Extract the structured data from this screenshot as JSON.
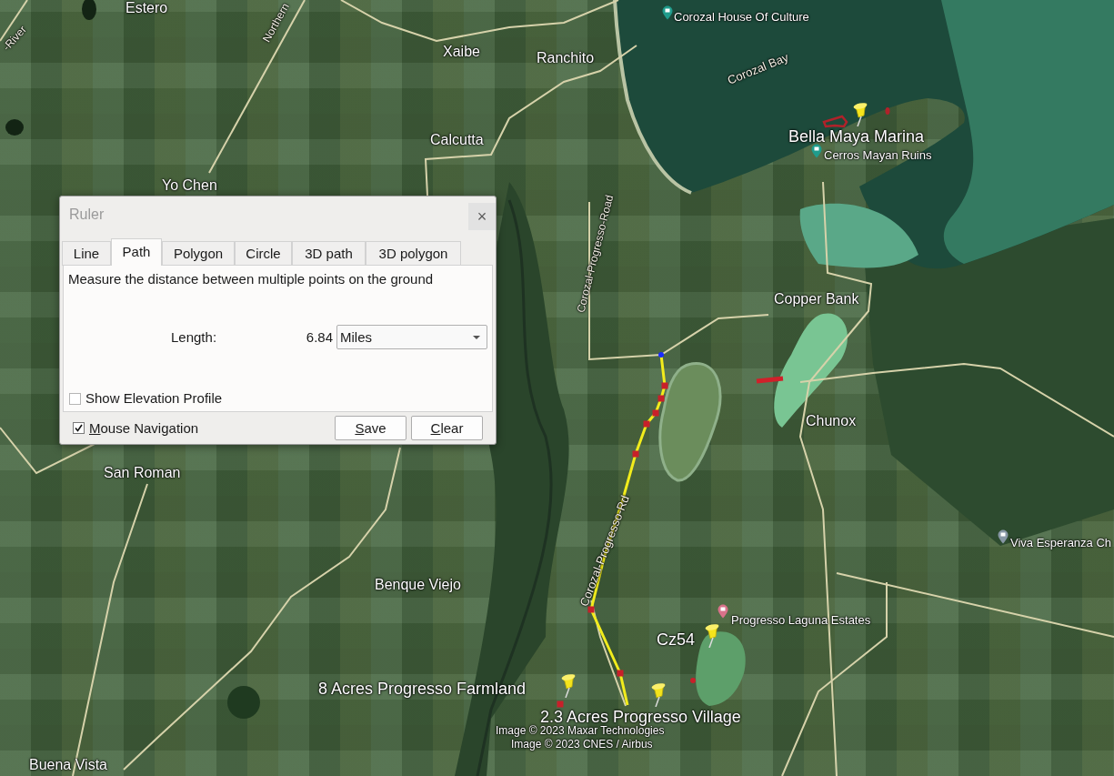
{
  "map": {
    "places": [
      "Estero",
      "Xaibe",
      "Ranchito",
      "Calcutta",
      "Yo Chen",
      "Copper Bank",
      "Chunox",
      "San Roman",
      "Benque Viejo",
      "Buena Vista"
    ],
    "road_labels": [
      "Northern",
      "-River",
      "Corozal Bay",
      "Corozal-Progresso-Road",
      "Corozal-Progresso-Rd"
    ],
    "pois": [
      {
        "text": "Corozal House Of Culture",
        "color": "#1f9c8c"
      },
      {
        "text": "Cerros Mayan Ruins",
        "color": "#1f9c8c"
      },
      {
        "text": "Viva Esperanza Ch",
        "color": "#8797a5"
      },
      {
        "text": "Progresso Laguna Estates",
        "color": "#d9728a"
      }
    ],
    "placemarks": [
      "Bella Maya Marina",
      "Cz54",
      "8 Acres Progresso Farmland",
      "2.3 Acres Progresso Village"
    ],
    "attribution": [
      "Image © 2023 Maxar Technologies",
      "Image © 2023 CNES / Airbus"
    ]
  },
  "ruler_dialog": {
    "title": "Ruler",
    "close_button": "×",
    "tabs": [
      {
        "label": "Line",
        "selected": false
      },
      {
        "label": "Path",
        "selected": true
      },
      {
        "label": "Polygon",
        "selected": false
      },
      {
        "label": "Circle",
        "selected": false
      },
      {
        "label": "3D path",
        "selected": false
      },
      {
        "label": "3D polygon",
        "selected": false
      }
    ],
    "description": "Measure the distance between multiple points on the ground",
    "length_label": "Length:",
    "length_value": "6.84",
    "unit": "Miles",
    "show_elevation_profile": {
      "label": "Show Elevation Profile",
      "checked": false
    },
    "mouse_navigation": {
      "label": "Mouse Navigation",
      "checked": true,
      "mnemonic": true
    },
    "buttons": [
      {
        "label": "Save",
        "mnemonic": true
      },
      {
        "label": "Clear",
        "mnemonic": true
      }
    ]
  }
}
